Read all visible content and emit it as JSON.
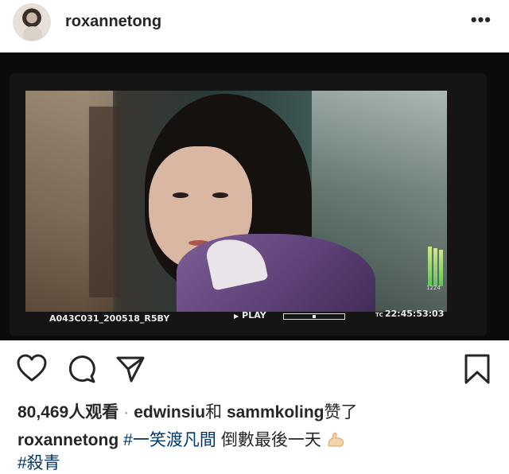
{
  "post": {
    "username": "roxannetong",
    "more_label": "•••"
  },
  "photo": {
    "hud": {
      "clip_name": "A043C031_200518_R5BY",
      "play_label": "PLAY",
      "timecode_prefix": "TC",
      "timecode": "22:45:53:03",
      "meter_label": "1224"
    }
  },
  "actions": {
    "like_icon": "heart-icon",
    "comment_icon": "comment-icon",
    "share_icon": "paper-plane-icon",
    "save_icon": "bookmark-icon"
  },
  "likes": {
    "count": "80,469",
    "count_suffix": "人观看",
    "separator": "·",
    "liker1": "edwinsiu",
    "and_text": "和",
    "liker2": "sammkoling",
    "liked_text": "赞了"
  },
  "caption": {
    "username": "roxannetong",
    "hashtag1": "#一笑渡凡間",
    "text": "倒數最後一天",
    "emoji": "flexed-biceps-icon",
    "hashtag2": "#殺青"
  }
}
